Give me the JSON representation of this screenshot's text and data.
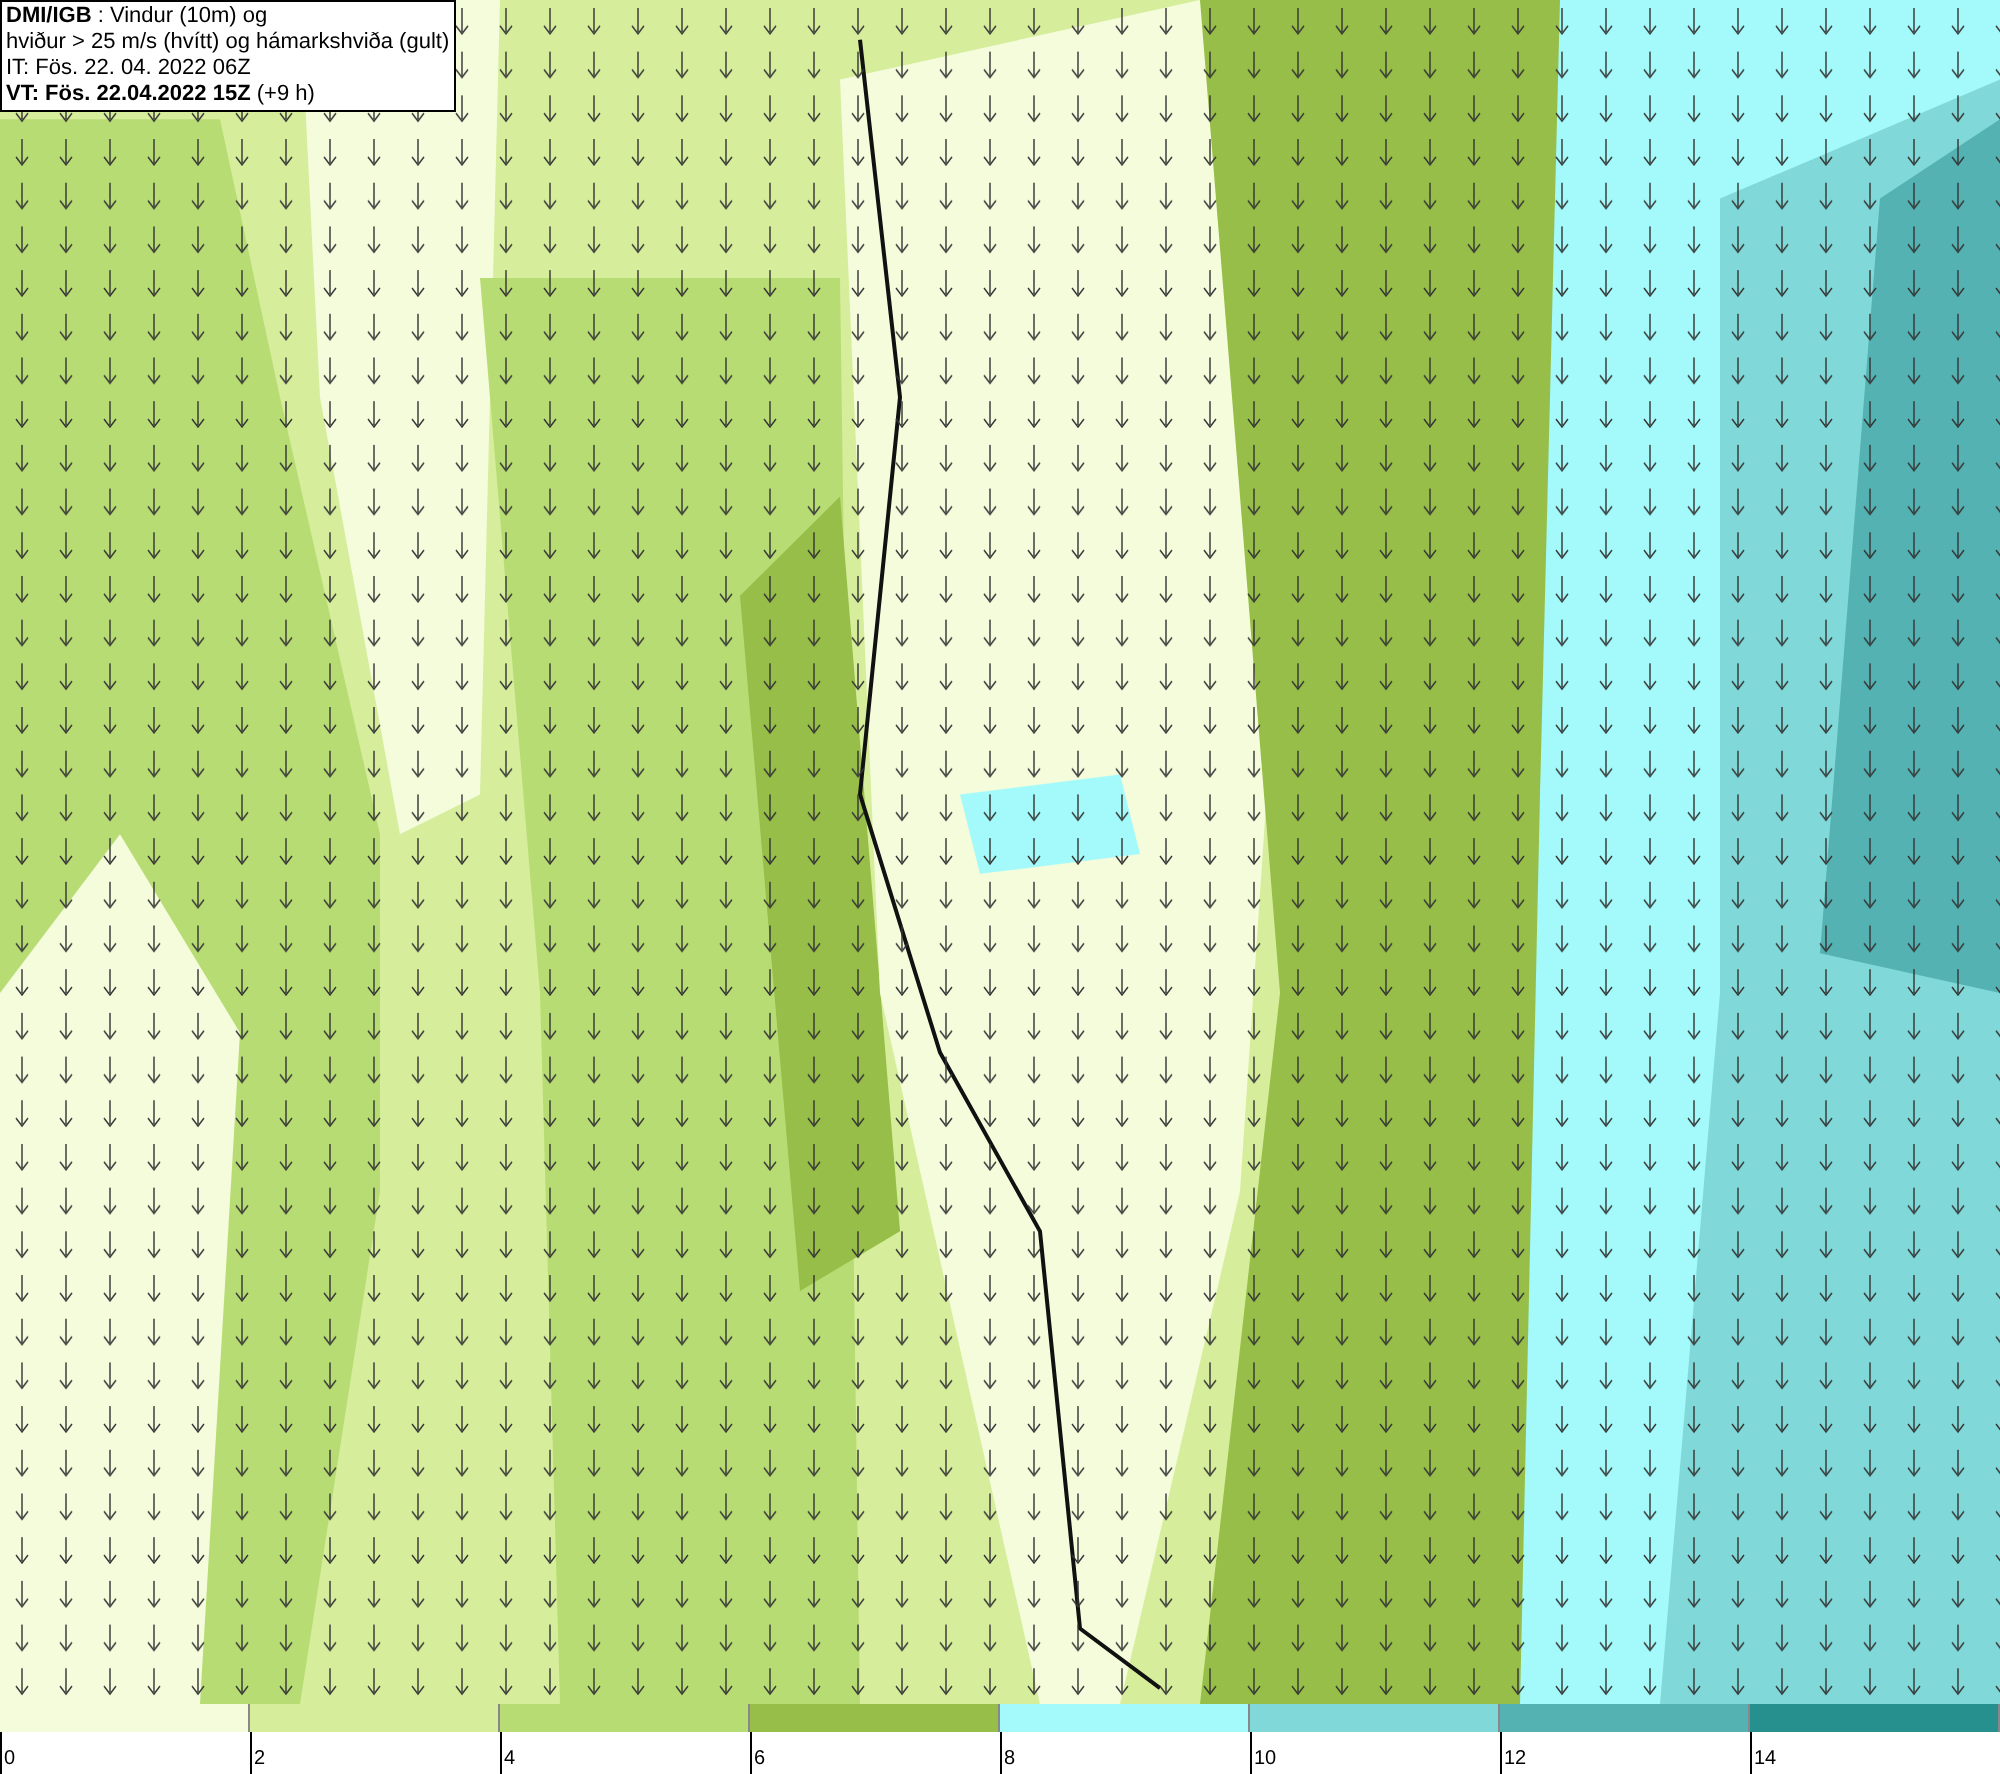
{
  "header": {
    "lines": [
      "**DMI/IGB** : Vindur (10m) og",
      "hviður > 25 m/s (hvítt) og hámarkshviða (gult)",
      "IT: Fös. 22. 04. 2022 06Z",
      "**VT: Fös. 22.04.2022 15Z** (+9 h)"
    ]
  },
  "legend": {
    "bins": [
      {
        "color": "#f4fcdc"
      },
      {
        "color": "#d6ee9c"
      },
      {
        "color": "#b8dc74"
      },
      {
        "color": "#96be48"
      },
      {
        "color": "#a4fafa"
      },
      {
        "color": "#80d8d8"
      },
      {
        "color": "#54b2b2"
      },
      {
        "color": "#26908e"
      }
    ],
    "ticks": [
      "0",
      "2",
      "4",
      "6",
      "8",
      "10",
      "12",
      "14"
    ]
  }
}
